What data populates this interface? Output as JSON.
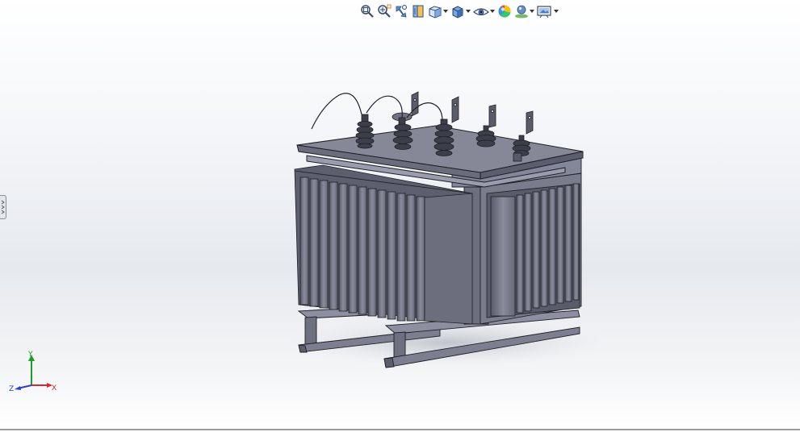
{
  "toolbar": {
    "buttons": [
      {
        "icon": "zoom-to-fit-icon",
        "dropdown": false
      },
      {
        "icon": "zoom-to-area-icon",
        "dropdown": false
      },
      {
        "icon": "previous-view-icon",
        "dropdown": false
      },
      {
        "icon": "section-view-icon",
        "dropdown": false
      },
      {
        "icon": "view-orientation-icon",
        "dropdown": true
      },
      {
        "icon": "display-style-icon",
        "dropdown": true
      },
      {
        "icon": "hide-show-items-icon",
        "dropdown": true
      },
      {
        "icon": "edit-appearance-icon",
        "dropdown": false
      },
      {
        "icon": "apply-scene-icon",
        "dropdown": true
      },
      {
        "icon": "view-settings-icon",
        "dropdown": true
      }
    ]
  },
  "triad": {
    "x_label": "X",
    "y_label": "Y",
    "z_label": "Z",
    "x_color": "#d42a2a",
    "y_color": "#1f9a2e",
    "z_color": "#2c3fc9"
  },
  "model": {
    "body_color": "#7b7d8e",
    "dark_color": "#3c3e4a",
    "outline_color": "#1e1f26"
  }
}
